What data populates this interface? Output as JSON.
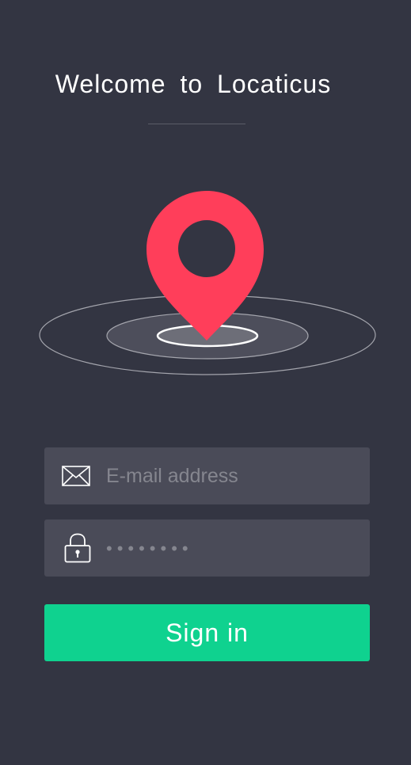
{
  "header": {
    "title": "Welcome to Locaticus"
  },
  "hero": {
    "icon": "location-pin-icon",
    "pin_color": "#ff3e5a"
  },
  "form": {
    "email": {
      "icon": "envelope-icon",
      "placeholder": "E-mail address",
      "value": ""
    },
    "password": {
      "icon": "lock-icon",
      "placeholder": "••••••••",
      "value": ""
    },
    "signin_label": "Sign in"
  },
  "colors": {
    "background": "#333542",
    "field_background": "#4a4b58",
    "accent": "#0fd28f",
    "pin": "#ff3e5a"
  }
}
